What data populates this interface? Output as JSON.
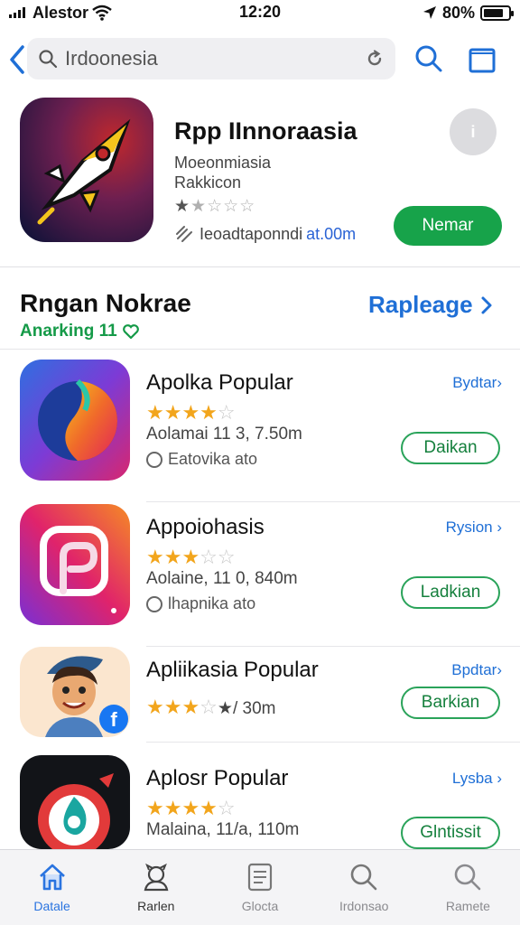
{
  "status": {
    "carrier": "Alestor",
    "time": "12:20",
    "battery": "80%",
    "battery_level": 0.8
  },
  "search": {
    "query": "Irdoonesia"
  },
  "featured": {
    "title": "Rpp IInnoraasia",
    "subtitle1": "Moeonmiasia",
    "subtitle2": "Rakkicon",
    "rating": 1,
    "stars": "★☆☆☆",
    "meta_a": "Ieoadtaponndi",
    "meta_b": "at.00m",
    "info_label": "i",
    "get_label": "Nemar",
    "accent_color": "#17a34a"
  },
  "section": {
    "title": "Rngan Nokrae",
    "subtitle": "Anarking 11",
    "link": "Rapleage"
  },
  "apps": [
    {
      "name": "Apolka Popular",
      "stars_on": "★★★★",
      "stars_off": "☆",
      "meta1": "Aolamai 11 3, 7.50m",
      "meta2": "Eatovika ato",
      "link": "Bydtar›",
      "button": "Daikan"
    },
    {
      "name": "Appoiohasis",
      "stars_on": "★★★",
      "stars_off": "☆☆",
      "meta1": "Aolaine, 11 0,  840m",
      "meta2": "lhapnika ato",
      "link": "Rysion ›",
      "button": "Ladkian"
    },
    {
      "name": "Apliikasia Popular",
      "stars_on": "★★★",
      "stars_off": "☆",
      "meta1": "",
      "meta_inline": "★/ 30m",
      "meta2": "",
      "link": "Bpdtar›",
      "button": "Barkian"
    },
    {
      "name": "Aplosr Popular",
      "stars_on": "★★★★",
      "stars_off": "☆",
      "meta1": "Malaina, 11/a, 110m",
      "meta2": "",
      "link": "Lysba ›",
      "button": "Glntissit"
    }
  ],
  "tabs": [
    {
      "label": "Datale",
      "icon": "home-icon",
      "active": true
    },
    {
      "label": "Rarlen",
      "icon": "person-icon",
      "active": false
    },
    {
      "label": "Glocta",
      "icon": "document-icon",
      "active": false
    },
    {
      "label": "Irdonsao",
      "icon": "search-icon",
      "active": false
    },
    {
      "label": "Ramete",
      "icon": "search-icon",
      "active": false
    }
  ],
  "colors": {
    "blue": "#1f6fd6",
    "green": "#17a34a",
    "star": "#f2a51c"
  }
}
